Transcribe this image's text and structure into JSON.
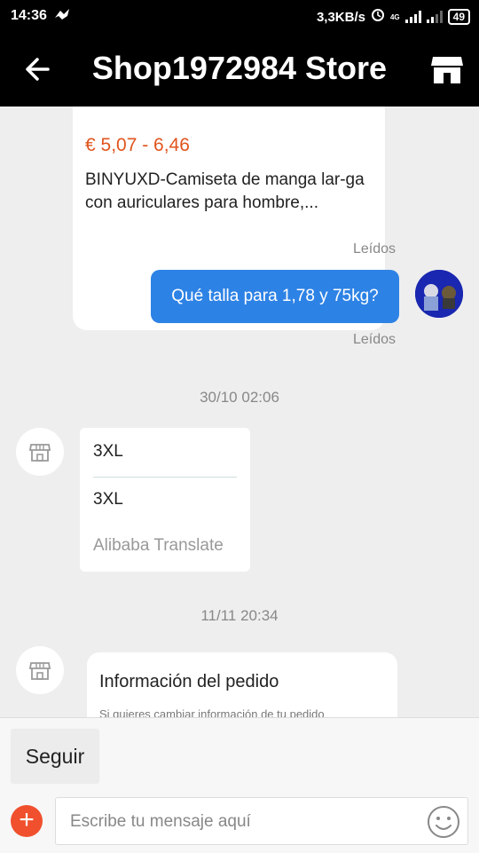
{
  "status_bar": {
    "time": "14:36",
    "speed": "3,3KB/s",
    "network": "4G",
    "battery": "49"
  },
  "header": {
    "title": "Shop1972984 Store"
  },
  "product_card": {
    "price": "€ 5,07 - 6,46",
    "name": "BINYUXD-Camiseta de manga lar-ga con auriculares para hombre,..."
  },
  "messages": {
    "read_label_1": "Leídos",
    "outgoing_text": "Qué talla para 1,78 y 75kg?",
    "read_label_2": "Leídos",
    "timestamp_1": "30/10 02:06",
    "translated_reply": {
      "original": "3XL",
      "translation": "3XL",
      "provider": "Alibaba Translate"
    },
    "timestamp_2": "11/11 20:34",
    "order_info": {
      "title": "Información del pedido",
      "subtitle": "Si quieres cambiar información de tu pedido"
    }
  },
  "bottom_bar": {
    "follow_label": "Seguir",
    "add_label": "+",
    "input_placeholder": "Escribe tu mensaje aquí"
  },
  "colors": {
    "accent_blue": "#2d82e5",
    "price_orange": "#e0541e",
    "add_button": "#f0502d"
  },
  "icons": [
    "back-arrow-icon",
    "store-icon",
    "smiley-icon",
    "plus-icon",
    "shop-avatar-icon"
  ]
}
